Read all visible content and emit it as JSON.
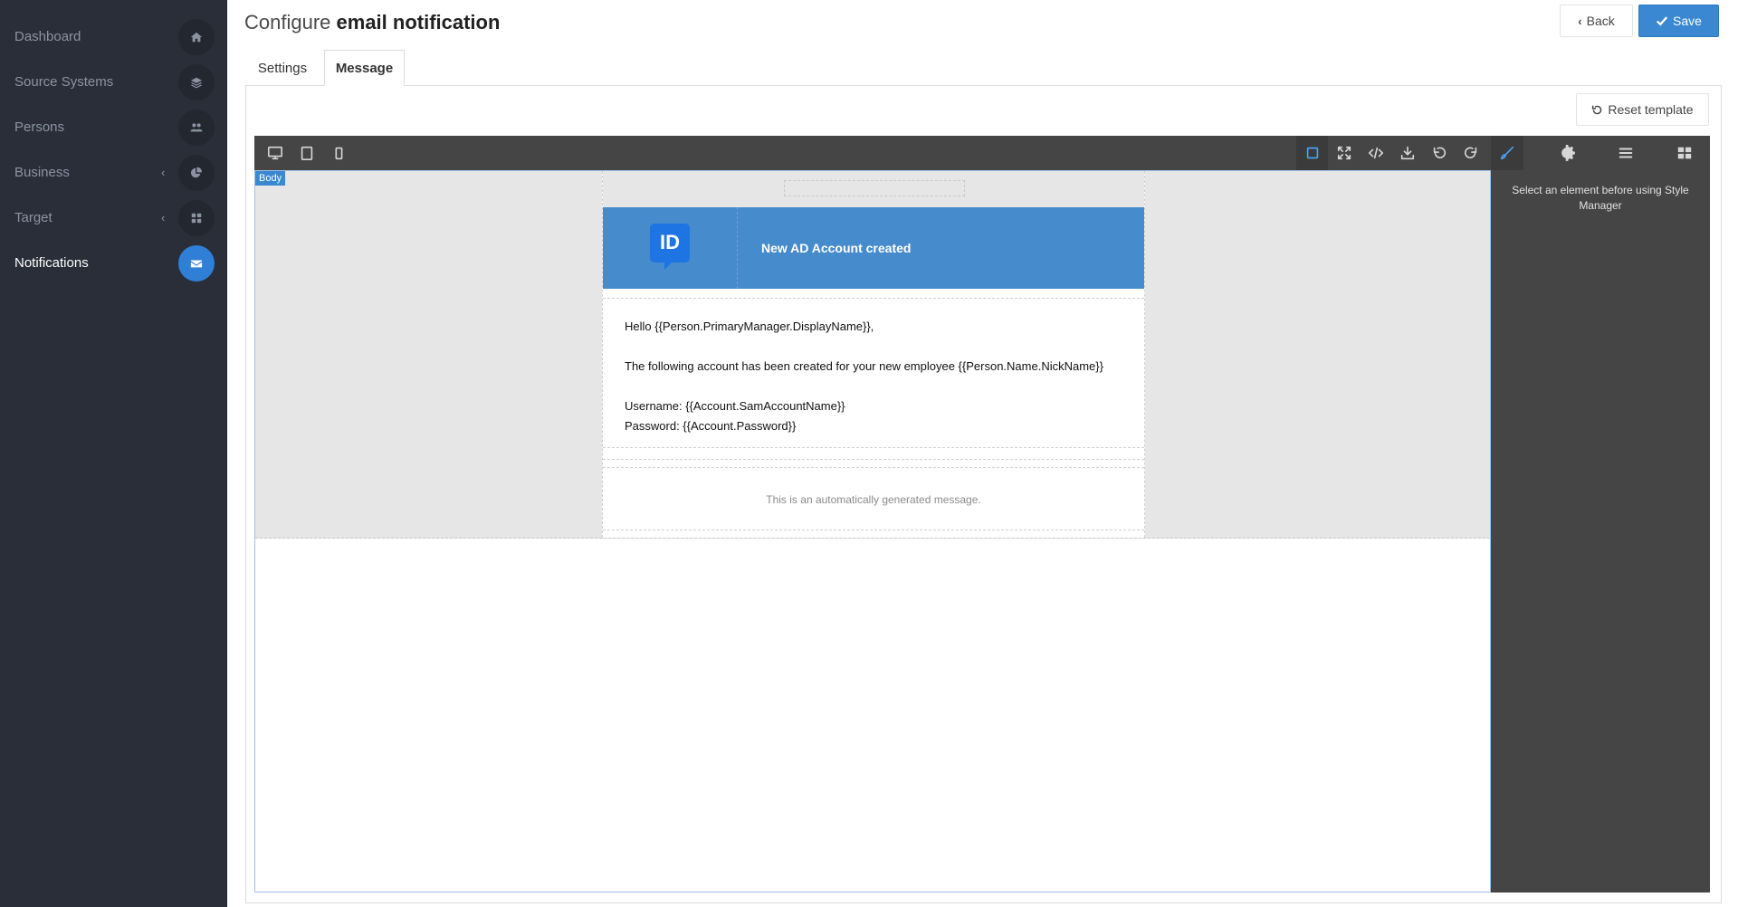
{
  "sidebar": {
    "items": [
      {
        "label": "Dashboard",
        "icon": "home-icon"
      },
      {
        "label": "Source Systems",
        "icon": "layers-icon"
      },
      {
        "label": "Persons",
        "icon": "users-icon"
      },
      {
        "label": "Business",
        "icon": "pie-chart-icon",
        "chevron": "‹"
      },
      {
        "label": "Target",
        "icon": "grid-icon",
        "chevron": "‹"
      },
      {
        "label": "Notifications",
        "icon": "envelope-icon",
        "active": true
      }
    ]
  },
  "header": {
    "title_prefix": "Configure",
    "title_bold": "email notification",
    "back_label": "Back",
    "save_label": "Save"
  },
  "tabs": [
    {
      "label": "Settings",
      "active": false
    },
    {
      "label": "Message",
      "active": true
    }
  ],
  "message": {
    "reset_label": "Reset template",
    "editor": {
      "body_badge": "Body",
      "style_manager_hint": "Select an element before using Style Manager"
    },
    "email": {
      "logo_text": "ID",
      "header_title": "New AD Account created",
      "greeting": "Hello {{Person.PrimaryManager.DisplayName}},",
      "line1": "The following account has been created for your new employee {{Person.Name.NickName}}",
      "username_line": "Username: {{Account.SamAccountName}}",
      "password_line": "Password: {{Account.Password}}",
      "footer": "This is an automatically generated message."
    }
  },
  "colors": {
    "sidebar_bg": "#2a2e38",
    "accent": "#3a87d2",
    "email_header": "#468bcc",
    "editor_dark": "#454545"
  }
}
